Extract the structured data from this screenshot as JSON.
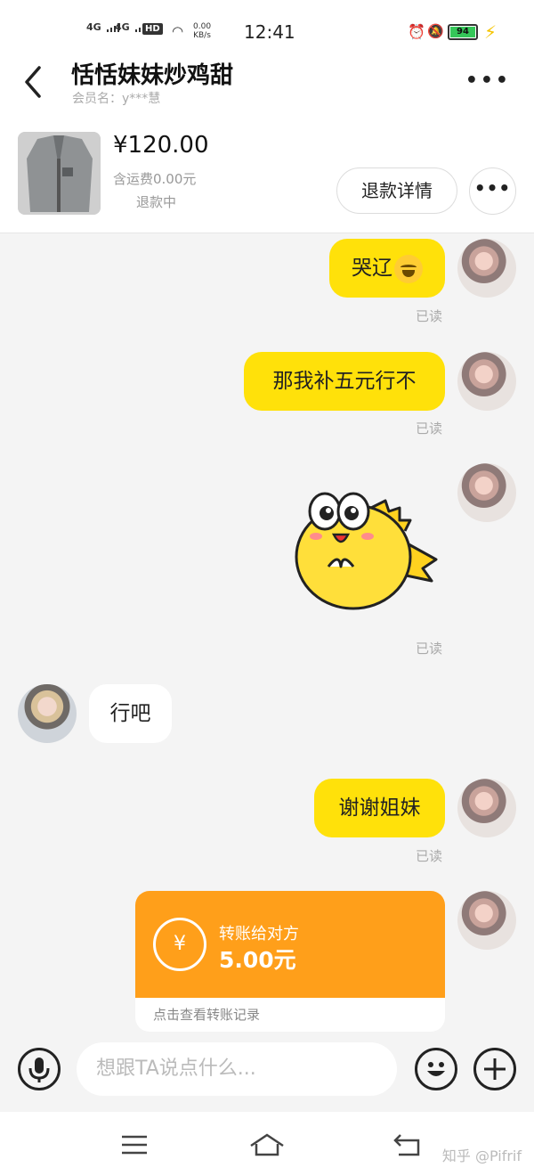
{
  "status_bar": {
    "net1": "4G",
    "net2": "4G",
    "hd": "HD",
    "speed_value": "0.00",
    "speed_unit": "KB/s",
    "time": "12:41",
    "battery": "94"
  },
  "header": {
    "title": "恬恬妹妹炒鸡甜",
    "subtitle": "会员名：y***慧"
  },
  "product": {
    "price": "¥120.00",
    "shipping": "含运费0.00元",
    "status": "退款中",
    "refund_button": "退款详情"
  },
  "messages": {
    "m1": "哭辽",
    "m2": "那我补五元行不",
    "m4": "行吧",
    "m5": "谢谢姐妹",
    "read_label": "已读"
  },
  "transfer": {
    "label": "转账给对方",
    "amount": "5.00元",
    "link": "点击查看转账记录",
    "icon": "¥"
  },
  "input": {
    "placeholder": "想跟TA说点什么..."
  },
  "watermark": "知乎 @Pifrif",
  "colors": {
    "my_bubble": "#ffe10a",
    "transfer_card": "#ff9f1a",
    "background": "#f4f4f4"
  }
}
